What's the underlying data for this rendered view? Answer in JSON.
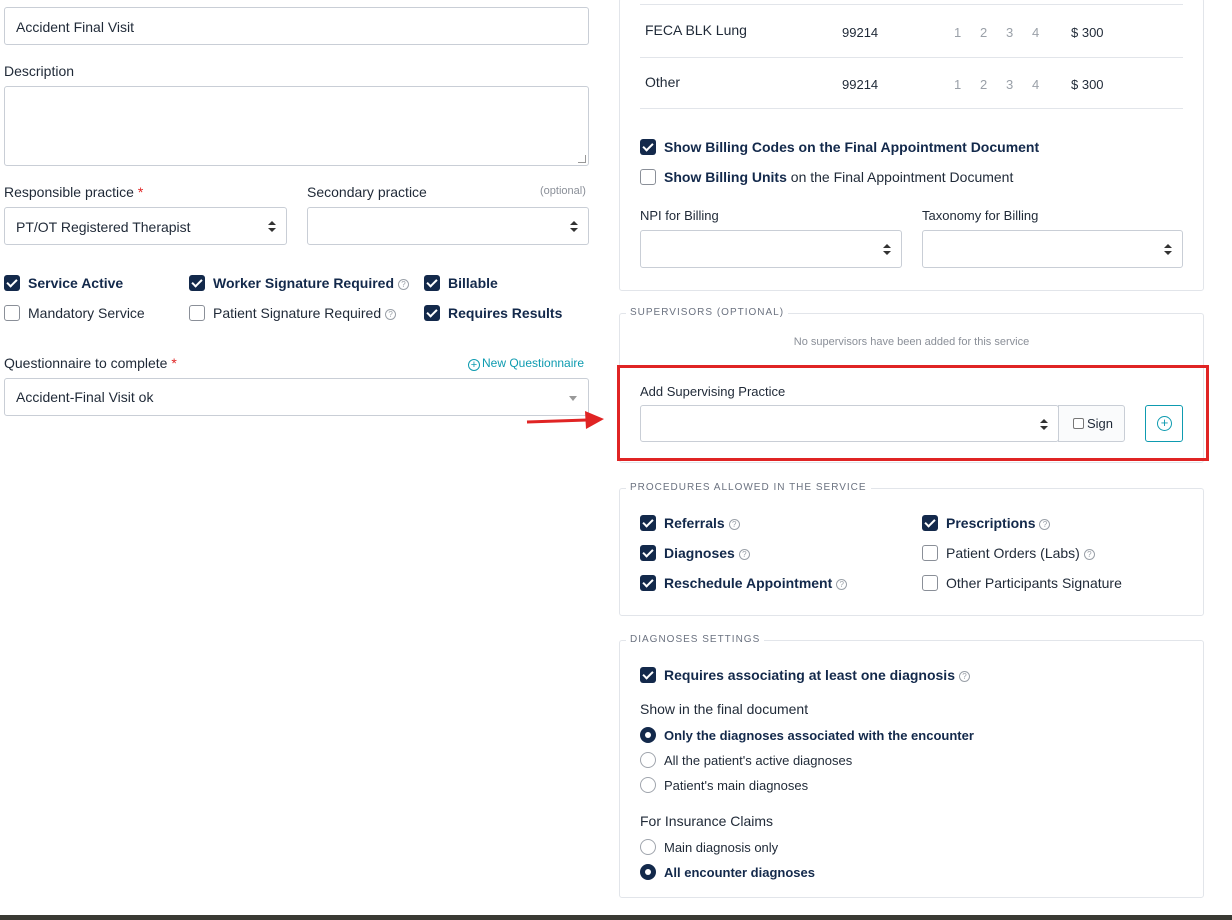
{
  "left": {
    "name_value": "Accident Final Visit",
    "description_label": "Description",
    "responsible_label": "Responsible practice",
    "required_mark": "*",
    "responsible_value": "PT/OT Registered Therapist",
    "secondary_label": "Secondary practice",
    "optional_label": "(optional)",
    "checkboxes": {
      "service_active": "Service Active",
      "worker_signature": "Worker Signature Required",
      "billable": "Billable",
      "mandatory_service": "Mandatory Service",
      "patient_signature": "Patient Signature Required",
      "requires_results": "Requires Results"
    },
    "questionnaire_label": "Questionnaire to complete",
    "new_questionnaire": "New Questionnaire",
    "questionnaire_value": "Accident-Final Visit ok"
  },
  "billing": {
    "rows": [
      {
        "name": "FECA BLK Lung",
        "code": "99214",
        "units": [
          "1",
          "2",
          "3",
          "4"
        ],
        "price": "$ 300"
      },
      {
        "name": "Other",
        "code": "99214",
        "units": [
          "1",
          "2",
          "3",
          "4"
        ],
        "price": "$ 300"
      }
    ],
    "show_codes_bold": "Show Billing Codes on the Final Appointment Document",
    "show_units_bold": "Show Billing Units",
    "show_units_rest": " on the Final Appointment Document",
    "npi_label": "NPI for Billing",
    "taxonomy_label": "Taxonomy for Billing"
  },
  "supervisors": {
    "legend": "SUPERVISORS (OPTIONAL)",
    "empty_text": "No supervisors have been added for this service",
    "add_label": "Add Supervising Practice",
    "sign_label": "Sign"
  },
  "procedures": {
    "legend": "PROCEDURES ALLOWED IN THE SERVICE",
    "referrals": "Referrals",
    "prescriptions": "Prescriptions",
    "diagnoses": "Diagnoses",
    "patient_orders": "Patient Orders (Labs)",
    "reschedule": "Reschedule Appointment",
    "other_participants": "Other Participants Signature"
  },
  "diagnoses_settings": {
    "legend": "DIAGNOSES SETTINGS",
    "requires_one": "Requires associating at least one diagnosis",
    "show_final_label": "Show in the final document",
    "opt_encounter": "Only the diagnoses associated with the encounter",
    "opt_active": "All the patient's active diagnoses",
    "opt_main": "Patient's main diagnoses",
    "claims_label": "For Insurance Claims",
    "opt_main_only": "Main diagnosis only",
    "opt_all_encounter": "All encounter diagnoses"
  },
  "colors": {
    "navy": "#13294b",
    "accent": "#0e9bb0",
    "highlight": "#e02424",
    "required": "#e02424"
  }
}
